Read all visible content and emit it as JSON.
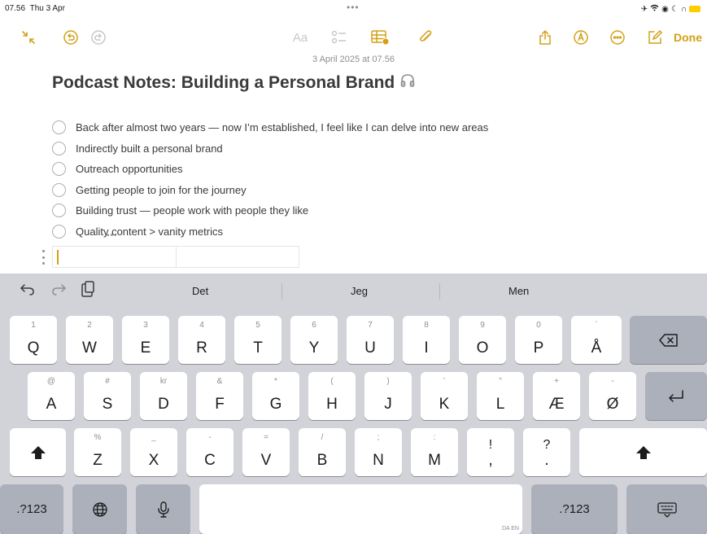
{
  "status_bar": {
    "time": "07.56",
    "date": "Thu 3 Apr",
    "dots": "•••"
  },
  "toolbar": {
    "format_label": "Aa",
    "done_label": "Done"
  },
  "note": {
    "date": "3 April 2025 at 07.56",
    "title": "Podcast Notes: Building a Personal Brand",
    "title_icon": "headphones-icon",
    "checklist": [
      "Back after almost two years — now I’m established, I feel like I can delve into new areas",
      "Indirectly built a personal brand",
      "Outreach opportunities",
      "Getting people to join for the journey",
      "Building trust — people work with people they like",
      "Quality content > vanity metrics"
    ],
    "table_dots": "•••"
  },
  "keyboard": {
    "suggestions": [
      "Det",
      "Jeg",
      "Men"
    ],
    "row1": [
      {
        "main": "Q",
        "alt": "1"
      },
      {
        "main": "W",
        "alt": "2"
      },
      {
        "main": "E",
        "alt": "3"
      },
      {
        "main": "R",
        "alt": "4"
      },
      {
        "main": "T",
        "alt": "5"
      },
      {
        "main": "Y",
        "alt": "6"
      },
      {
        "main": "U",
        "alt": "7"
      },
      {
        "main": "I",
        "alt": "8"
      },
      {
        "main": "O",
        "alt": "9"
      },
      {
        "main": "P",
        "alt": "0"
      },
      {
        "main": "Å",
        "alt": "`"
      }
    ],
    "row2": [
      {
        "main": "A",
        "alt": "@"
      },
      {
        "main": "S",
        "alt": "#"
      },
      {
        "main": "D",
        "alt": "kr"
      },
      {
        "main": "F",
        "alt": "&"
      },
      {
        "main": "G",
        "alt": "*"
      },
      {
        "main": "H",
        "alt": "("
      },
      {
        "main": "J",
        "alt": ")"
      },
      {
        "main": "K",
        "alt": "’"
      },
      {
        "main": "L",
        "alt": "”"
      },
      {
        "main": "Æ",
        "alt": "+"
      },
      {
        "main": "Ø",
        "alt": "-"
      }
    ],
    "row3": [
      {
        "main": "Z",
        "alt": "%"
      },
      {
        "main": "X",
        "alt": "_"
      },
      {
        "main": "C",
        "alt": "-"
      },
      {
        "main": "V",
        "alt": "="
      },
      {
        "main": "B",
        "alt": "/"
      },
      {
        "main": "N",
        "alt": ";"
      },
      {
        "main": "M",
        "alt": ":"
      },
      {
        "main": ",",
        "alt": "!"
      },
      {
        "main": ".",
        "alt": "?"
      }
    ],
    "numbers_label": ".?123",
    "language_label": "DA EN"
  },
  "colors": {
    "accent": "#d4a017",
    "keyboard_bg": "#d1d3d9",
    "key_dark": "#abb0bb"
  }
}
